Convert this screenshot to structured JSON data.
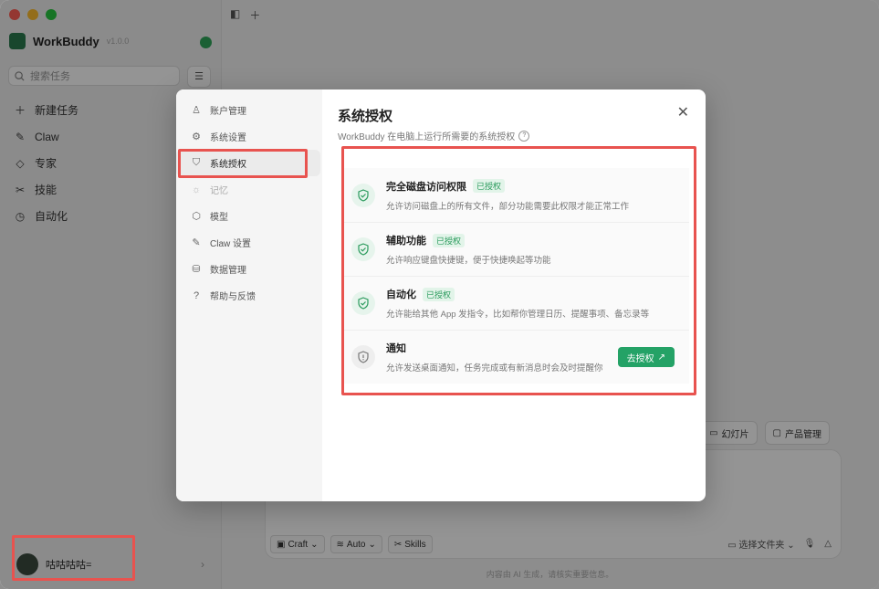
{
  "app": {
    "name": "WorkBuddy",
    "version": "v1.0.0"
  },
  "sidebar": {
    "search_placeholder": "搜索任务",
    "items": [
      {
        "label": "新建任务",
        "icon": "plus-icon"
      },
      {
        "label": "Claw",
        "icon": "claw-icon"
      },
      {
        "label": "专家",
        "icon": "graduation-cap-icon"
      },
      {
        "label": "技能",
        "icon": "tools-icon"
      },
      {
        "label": "自动化",
        "icon": "clock-icon"
      }
    ],
    "user": {
      "name": "咕咕咕咕="
    }
  },
  "main": {
    "chips": [
      "幻灯片",
      "产品管理"
    ],
    "composer": {
      "mode": "Craft",
      "model": "Auto",
      "skills": "Skills",
      "folder": "选择文件夹"
    },
    "disclaimer": "内容由 AI 生成，请核实重要信息。"
  },
  "modal": {
    "title": "系统授权",
    "subtitle": "WorkBuddy 在电脑上运行所需要的系统授权",
    "nav": [
      {
        "label": "账户管理",
        "icon": "user-icon"
      },
      {
        "label": "系统设置",
        "icon": "gear-icon"
      },
      {
        "label": "系统授权",
        "icon": "shield-icon"
      },
      {
        "label": "记忆",
        "icon": "brain-icon"
      },
      {
        "label": "模型",
        "icon": "cube-icon"
      },
      {
        "label": "Claw 设置",
        "icon": "claw-icon"
      },
      {
        "label": "数据管理",
        "icon": "database-icon"
      },
      {
        "label": "帮助与反馈",
        "icon": "help-icon"
      }
    ],
    "permissions": [
      {
        "title": "完全磁盘访问权限",
        "status": "已授权",
        "desc": "允许访问磁盘上的所有文件，部分功能需要此权限才能正常工作"
      },
      {
        "title": "辅助功能",
        "status": "已授权",
        "desc": "允许响应键盘快捷键，便于快捷唤起等功能"
      },
      {
        "title": "自动化",
        "status": "已授权",
        "desc": "允许能给其他 App 发指令，比如帮你管理日历、提醒事项、备忘录等"
      },
      {
        "title": "通知",
        "status": "",
        "desc": "允许发送桌面通知，任务完成或有新消息时会及时提醒你",
        "action": "去授权"
      }
    ]
  },
  "colors": {
    "accent": "#24a266",
    "highlight": "#e8534f",
    "granted_bg": "#e2f4e9"
  }
}
